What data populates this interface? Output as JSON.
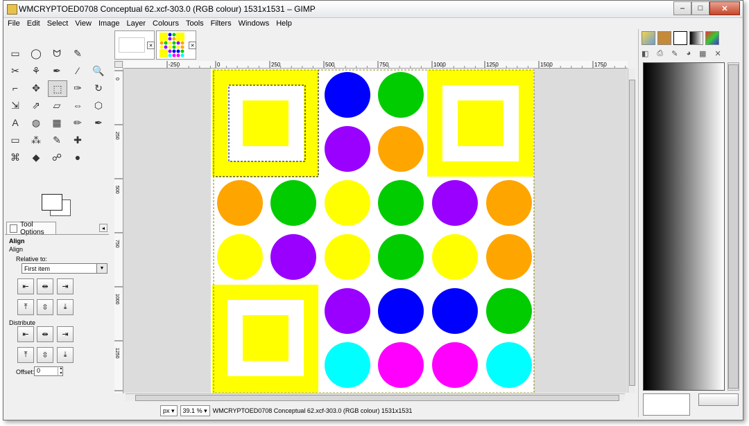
{
  "window": {
    "title": "WMCRYPTOED0708 Conceptual 62.xcf-303.0 (RGB colour) 1531x1531 – GIMP",
    "controls": [
      "–",
      "□",
      "✕"
    ]
  },
  "menu": [
    "File",
    "Edit",
    "Select",
    "View",
    "Image",
    "Layer",
    "Colours",
    "Tools",
    "Filters",
    "Windows",
    "Help"
  ],
  "tools": [
    "rect-select-icon",
    "ellipse-select-icon",
    "free-select-icon",
    "fuzzy-select-icon",
    "empty",
    "scissors-icon",
    "foreground-select-icon",
    "paths-icon",
    "color-picker-icon",
    "zoom-icon",
    "measure-icon",
    "move-icon",
    "align-icon",
    "crop-icon",
    "rotate-icon",
    "scale-icon",
    "shear-icon",
    "perspective-icon",
    "flip-icon",
    "cage-icon",
    "text-icon",
    "bucket-fill-icon",
    "blend-icon",
    "pencil-icon",
    "paintbrush-icon",
    "eraser-icon",
    "airbrush-icon",
    "ink-icon",
    "heal-icon",
    "empty",
    "clone-icon",
    "blur-icon",
    "smudge-icon",
    "dodge-icon",
    "empty"
  ],
  "tool_glyphs": [
    "▭",
    "◯",
    "ᗢ",
    "✎",
    "",
    "✂",
    "⚘",
    "✒",
    "⁄",
    "🔍",
    "⌐",
    "✥",
    "⬚",
    "✑",
    "↻",
    "⇲",
    "⇗",
    "▱",
    "⇔",
    "⬡",
    "A",
    "◍",
    "▦",
    "✏",
    "✒",
    "▭",
    "⁂",
    "✎",
    "✚",
    "",
    "⌘",
    "◆",
    "☍",
    "●",
    ""
  ],
  "tool_options": {
    "tab_label": "Tool Options",
    "heading": "Align",
    "subheading": "Align",
    "relative_to_label": "Relative to:",
    "relative_to_value": "First item",
    "distribute_label": "Distribute",
    "offset_label": "Offset:",
    "offset_value": "0",
    "align_buttons": [
      "⇤",
      "⇹",
      "⇥",
      "⤒",
      "⇳",
      "⤓"
    ],
    "distribute_buttons": [
      "⇤",
      "⇹",
      "⇥",
      "⤒",
      "⇳",
      "⤓"
    ]
  },
  "image_tabs": [
    {
      "label": "",
      "close": "✕"
    },
    {
      "label": "",
      "close": "✕"
    }
  ],
  "ruler": {
    "top_labels": [
      "-250",
      "0",
      "250",
      "500",
      "750",
      "1000",
      "1250",
      "1500",
      "1750"
    ],
    "left_labels": [
      "0",
      "250",
      "500",
      "750",
      "1000",
      "1250",
      "1500"
    ]
  },
  "canvas": {
    "colors": {
      "yellow": "#ffff00",
      "blue": "#0000ff",
      "green": "#00cc00",
      "purple": "#9900ff",
      "orange": "#ffa500",
      "magenta": "#ff00ff",
      "cyan": "#00ffff"
    },
    "circles": [
      {
        "name": "circle-r0c2",
        "color": "blue"
      },
      {
        "name": "circle-r0c3",
        "color": "green"
      },
      {
        "name": "circle-r1c2",
        "color": "purple"
      },
      {
        "name": "circle-r1c3",
        "color": "orange"
      },
      {
        "name": "circle-r2c0",
        "color": "orange"
      },
      {
        "name": "circle-r2c1",
        "color": "green"
      },
      {
        "name": "circle-r2c2",
        "color": "yellow"
      },
      {
        "name": "circle-r2c3",
        "color": "green"
      },
      {
        "name": "circle-r2c4",
        "color": "purple"
      },
      {
        "name": "circle-r2c5",
        "color": "orange"
      },
      {
        "name": "circle-r3c0",
        "color": "yellow"
      },
      {
        "name": "circle-r3c1",
        "color": "purple"
      },
      {
        "name": "circle-r3c2",
        "color": "yellow"
      },
      {
        "name": "circle-r3c3",
        "color": "green"
      },
      {
        "name": "circle-r3c4",
        "color": "yellow"
      },
      {
        "name": "circle-r3c5",
        "color": "orange"
      },
      {
        "name": "circle-r4c2",
        "color": "purple"
      },
      {
        "name": "circle-r4c3",
        "color": "blue"
      },
      {
        "name": "circle-r4c4",
        "color": "blue"
      },
      {
        "name": "circle-r4c5",
        "color": "green"
      },
      {
        "name": "circle-r5c2",
        "color": "cyan"
      },
      {
        "name": "circle-r5c3",
        "color": "magenta"
      },
      {
        "name": "circle-r5c4",
        "color": "magenta"
      },
      {
        "name": "circle-r5c5",
        "color": "cyan"
      }
    ]
  },
  "statusbar": {
    "unit": "px",
    "zoom": "39.1 %",
    "info": "WMCRYPTOED0708 Conceptual 62.xcf-303.0 (RGB colour) 1531x1531"
  },
  "dock": {
    "tab_icons": [
      "palette-icon",
      "pattern-icon",
      "brushes-icon",
      "gradient-icon",
      "colormap-icon"
    ]
  }
}
